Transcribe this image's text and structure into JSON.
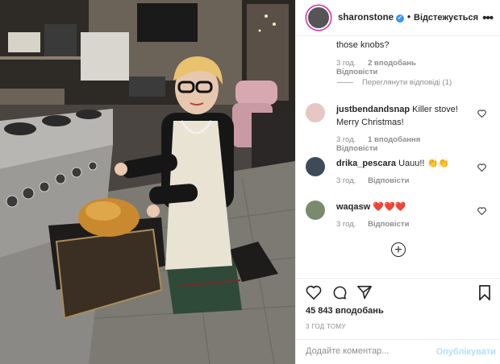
{
  "post": {
    "username": "sharonstone",
    "follow_state": "Відстежується",
    "more_icon": "more-horizontal-icon"
  },
  "comments": {
    "partial": {
      "text": "those knobs?",
      "time": "3 год.",
      "likes": "2 вподобань",
      "reply": "Відповісти",
      "view_replies": "Переглянути відповіді (1)"
    },
    "items": [
      {
        "user": "justbendandsnap",
        "text": "Killer stove! Merry Christmas!",
        "time": "3 год.",
        "likes": "1 вподобання",
        "reply": "Відповісти",
        "avatar_color": "#e6c7c4"
      },
      {
        "user": "drika_pescara",
        "text": "Uauu!! 👏👏",
        "time": "3 год.",
        "likes": "",
        "reply": "Відповісти",
        "avatar_color": "#3d4b58"
      },
      {
        "user": "waqasw",
        "text": "❤️❤️❤️",
        "time": "3 год.",
        "likes": "",
        "reply": "Відповісти",
        "avatar_color": "#7a8a6d"
      }
    ]
  },
  "actions": {
    "like_icon": "heart-icon",
    "comment_icon": "comment-icon",
    "share_icon": "share-icon",
    "save_icon": "bookmark-icon"
  },
  "likes_count": "45 843 вподобань",
  "timestamp": "3 ГОД ТОМУ",
  "composer": {
    "placeholder": "Додайте коментар...",
    "publish": "Опублікувати"
  },
  "colors": {
    "verified": "#3897f0",
    "publish_disabled": "#b2dffc",
    "heart_red": "#ed4956"
  }
}
